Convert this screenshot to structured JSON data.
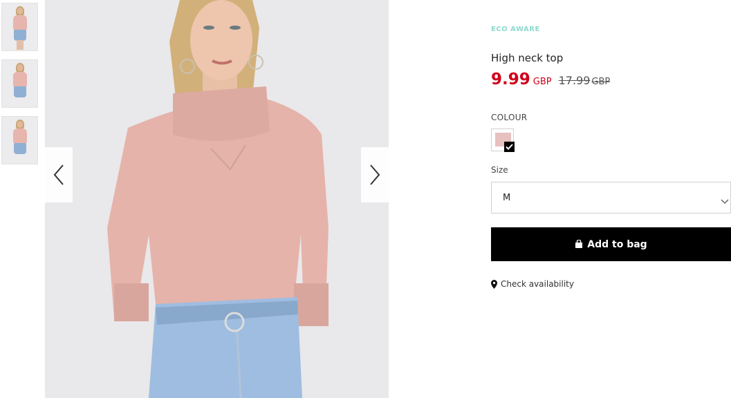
{
  "gallery": {
    "thumbnails": [
      "thumbnail-1",
      "thumbnail-2",
      "thumbnail-3"
    ],
    "icons": {
      "prev": "chevron-left-icon",
      "next": "chevron-right-icon"
    }
  },
  "product": {
    "badge": "ECO AWARE",
    "name": "High neck top",
    "price_now": "9.99",
    "currency_now": "GBP",
    "price_old": "17.99",
    "currency_old": "GBP"
  },
  "colour": {
    "label": "COLOUR",
    "selected_swatch_color": "#e7c0c0"
  },
  "size": {
    "label": "Size",
    "selected": "M"
  },
  "actions": {
    "add_to_bag": "Add to bag",
    "check_availability": "Check availability"
  },
  "colors": {
    "sale_red": "#d0021b",
    "eco_green": "#8ed9cd",
    "button_black": "#000000"
  }
}
